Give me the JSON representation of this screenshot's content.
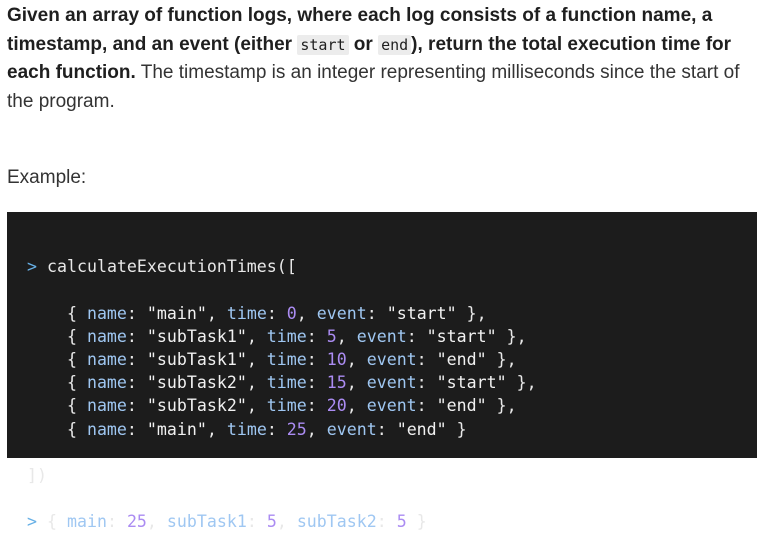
{
  "intro": {
    "bold_1": "Given an array of function logs, where each log consists of a function name, a timestamp, and an event (either ",
    "code_start": "start",
    "bold_2": " or ",
    "code_end": "end",
    "bold_3": "), return the total execution time for each function.",
    "rest": " The timestamp is an integer representing milliseconds since the start of the program."
  },
  "example_label": "Example:",
  "code": {
    "prompt": ">",
    "call_open": "calculateExecutionTimes([",
    "entries": [
      {
        "name": "\"main\"",
        "time": "0",
        "event": "\"start\"",
        "sep": " },"
      },
      {
        "name": "\"subTask1\"",
        "time": "5",
        "event": "\"start\"",
        "sep": " },"
      },
      {
        "name": "\"subTask1\"",
        "time": "10",
        "event": "\"end\"",
        "sep": " },"
      },
      {
        "name": "\"subTask2\"",
        "time": "15",
        "event": "\"start\"",
        "sep": " },"
      },
      {
        "name": "\"subTask2\"",
        "time": "20",
        "event": "\"end\"",
        "sep": " },"
      },
      {
        "name": "\"main\"",
        "time": "25",
        "event": "\"end\"",
        "sep": " }"
      }
    ],
    "keys": {
      "name": "name",
      "time": "time",
      "event": "event"
    },
    "call_close": "])",
    "result": {
      "items": [
        {
          "key": "main",
          "value": "25"
        },
        {
          "key": "subTask1",
          "value": "5"
        },
        {
          "key": "subTask2",
          "value": "5"
        }
      ]
    }
  }
}
